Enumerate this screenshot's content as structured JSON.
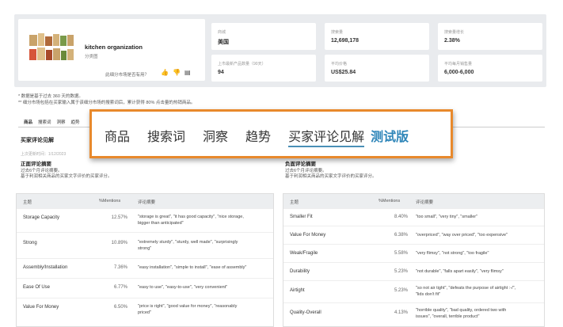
{
  "category": {
    "title": "kitchen organization",
    "subtitle": "分类图",
    "feedback_question": "此细分市场是否有用？"
  },
  "metrics": [
    {
      "label": "商城",
      "value": "美国"
    },
    {
      "label": "搜索量",
      "value": "12,698,178"
    },
    {
      "label": "搜索量增长",
      "value": "2.38%"
    },
    {
      "label": "上市最新产品数量（90天）",
      "value": "94"
    },
    {
      "label": "平均价格",
      "value": "US$25.84"
    },
    {
      "label": "平均每月销售量",
      "value": "6,000-6,000"
    }
  ],
  "notes": [
    "* 数据是基于过去 360 天的数据。",
    "** 细分市场包括在买家输入属于该细分市场的搜索词后，累计获得 80% 点击量的热销商品。"
  ],
  "small_tabs": [
    "商品",
    "搜索词",
    "洞察",
    "趋势"
  ],
  "overlay": {
    "tabs": [
      "商品",
      "搜索词",
      "洞察",
      "趋势",
      "买家评论见解"
    ],
    "beta": "测试版"
  },
  "section": {
    "title": "买家评论见解",
    "date": "上次更新时间：1/12/2023",
    "positive": {
      "title": "正面评论摘要",
      "desc": [
        "过去6个月评论摘要。",
        "基于利润相关商品的买家文字评价的买家评分。"
      ]
    },
    "negative": {
      "title": "负面评论摘要",
      "desc": [
        "过去6个月评论摘要。",
        "基于利润相关商品的买家文字评价的买家评分。"
      ]
    }
  },
  "table_headers": {
    "topic": "主题",
    "mentions": "%Mentions",
    "keywords": "评论摘要"
  },
  "positive_rows": [
    {
      "topic": "Storage Capacity",
      "pct": "12.57%",
      "kw": [
        "\"storage is great\", \"it has good capacity\", \"nice storage,",
        "bigger than anticipated\""
      ]
    },
    {
      "topic": "Strong",
      "pct": "10.89%",
      "kw": [
        "\"extremely sturdy\", \"sturdy, well made\", \"surprisingly",
        "strong\""
      ]
    },
    {
      "topic": "Assembly/Installation",
      "pct": "7.36%",
      "kw": [
        "\"easy installation\", \"simple to install\", \"ease of assembly\""
      ]
    },
    {
      "topic": "Ease Of Use",
      "pct": "6.77%",
      "kw": [
        "\"easy to use\", \"easy-to-use\", \"very convenient\""
      ]
    },
    {
      "topic": "Value For Money",
      "pct": "6.50%",
      "kw": [
        "\"price is right\", \"good value for money\", \"reasonably",
        "priced\""
      ]
    }
  ],
  "negative_rows": [
    {
      "topic": "Smaller Fit",
      "pct": "8.40%",
      "kw": [
        "\"too small\", \"very tiny\", \"smaller\""
      ]
    },
    {
      "topic": "Value For Money",
      "pct": "6.38%",
      "kw": [
        "\"overpriced\", \"way over priced\", \"too expensive\""
      ]
    },
    {
      "topic": "Weak/Fragile",
      "pct": "5.58%",
      "kw": [
        "\"very flimsy\", \"not strong\", \"too fragile\""
      ]
    },
    {
      "topic": "Durability",
      "pct": "5.23%",
      "kw": [
        "\"not durable\", \"falls apart easily\", \"very flimsy\""
      ]
    },
    {
      "topic": "Airtight",
      "pct": "5.23%",
      "kw": [
        "\"so not air tight\", \"defeats the purpose of airtight :-/\",",
        "\"lids don't fit\""
      ]
    },
    {
      "topic": "Quality-Overall",
      "pct": "4.13%",
      "kw": [
        "\"horrible quality\", \"bad quality, ordered two with",
        "issues\", \"overall, terrible product\""
      ]
    }
  ]
}
